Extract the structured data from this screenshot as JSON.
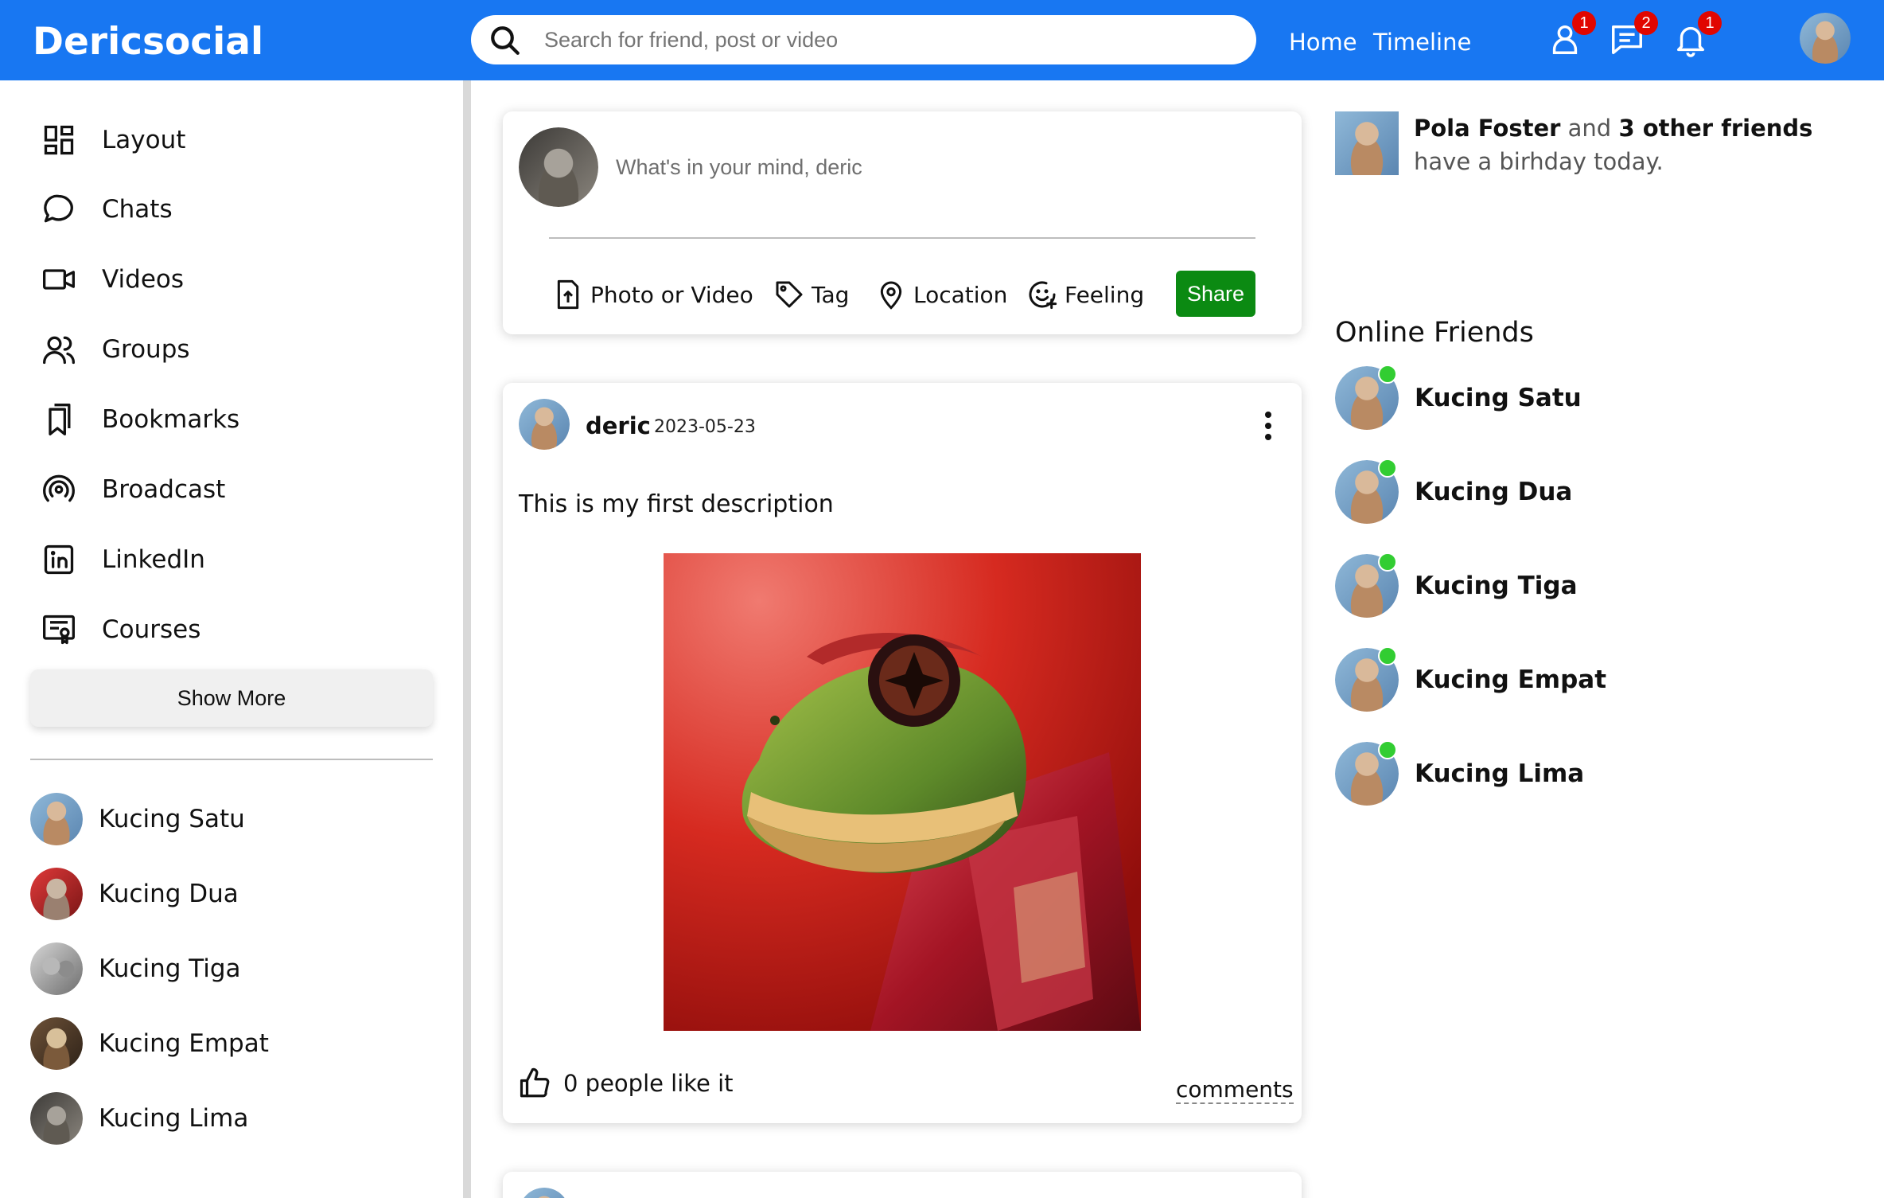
{
  "brand": {
    "name": "Dericsocial"
  },
  "search": {
    "placeholder": "Search for friend, post or video"
  },
  "nav": {
    "home": "Home",
    "timeline": "Timeline"
  },
  "notifications": {
    "friends": "1",
    "messages": "2",
    "alerts": "1"
  },
  "sidebar": {
    "items": [
      {
        "label": "Layout",
        "icon": "layout-icon"
      },
      {
        "label": "Chats",
        "icon": "chat-icon"
      },
      {
        "label": "Videos",
        "icon": "video-icon"
      },
      {
        "label": "Groups",
        "icon": "groups-icon"
      },
      {
        "label": "Bookmarks",
        "icon": "bookmark-icon"
      },
      {
        "label": "Broadcast",
        "icon": "broadcast-icon"
      },
      {
        "label": "LinkedIn",
        "icon": "linkedin-icon"
      },
      {
        "label": "Courses",
        "icon": "courses-icon"
      }
    ],
    "show_more": "Show More",
    "friends": [
      "Kucing Satu",
      "Kucing Dua",
      "Kucing Tiga",
      "Kucing Empat",
      "Kucing Lima"
    ]
  },
  "share": {
    "placeholder": "What's in your mind, deric",
    "options": {
      "photo": "Photo or Video",
      "tag": "Tag",
      "location": "Location",
      "feeling": "Feeling"
    },
    "button": "Share"
  },
  "post": {
    "username": "deric",
    "date": "2023-05-23",
    "description": "This is my first description",
    "likes": "0 people like it",
    "comments": "comments"
  },
  "birthday": {
    "name": "Pola Foster",
    "and": "and",
    "others": "3 other friends",
    "rest": "have a birhday today."
  },
  "online": {
    "title": "Online Friends",
    "friends": [
      "Kucing Satu",
      "Kucing Dua",
      "Kucing Tiga",
      "Kucing Empat",
      "Kucing Lima"
    ]
  },
  "colors": {
    "brand": "#1877f2",
    "share_button": "#0b8a12",
    "badge": "#e10600",
    "online": "#32cd32"
  }
}
